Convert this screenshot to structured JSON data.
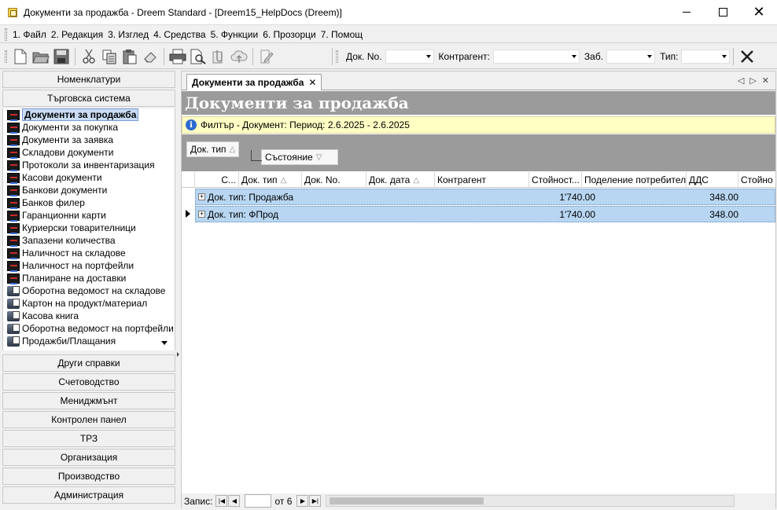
{
  "window": {
    "title": "Документи за продажба - Dreem Standard - [Dreem15_HelpDocs (Dreem)]",
    "controls": [
      "minimize",
      "maximize",
      "close"
    ]
  },
  "menu": [
    {
      "label": "1. Файл"
    },
    {
      "label": "2. Редакция"
    },
    {
      "label": "3. Изглед"
    },
    {
      "label": "4. Средства"
    },
    {
      "label": "5. Функции"
    },
    {
      "label": "6. Прозорци"
    },
    {
      "label": "7. Помощ"
    }
  ],
  "toolbar": {
    "icons": [
      "new-document-icon",
      "open-folder-icon",
      "save-icon",
      "cut-icon",
      "copy-icon",
      "paste-icon",
      "eraser-icon",
      "print-icon",
      "print-preview-icon",
      "attach-icon",
      "cloud-upload-icon",
      "edit-icon"
    ],
    "doc_no_label": "Док. No.",
    "counterparty_label": "Контрагент:",
    "note_label": "Заб.",
    "type_label": "Тип:",
    "close_icon": "close-x-icon"
  },
  "sidebar": {
    "top_groups": [
      {
        "label": "Номенклатури"
      },
      {
        "label": "Търговска система"
      }
    ],
    "items": [
      {
        "label": "Документи за продажба",
        "icon": "document-icon",
        "selected": true
      },
      {
        "label": "Документи за покупка",
        "icon": "document-icon"
      },
      {
        "label": "Документи за заявка",
        "icon": "document-icon"
      },
      {
        "label": "Складови документи",
        "icon": "document-icon"
      },
      {
        "label": "Протоколи за инвентаризация",
        "icon": "document-icon"
      },
      {
        "label": "Касови документи",
        "icon": "document-icon"
      },
      {
        "label": "Банкови документи",
        "icon": "document-icon"
      },
      {
        "label": "Банков филер",
        "icon": "document-icon"
      },
      {
        "label": "Гаранционни карти",
        "icon": "document-icon"
      },
      {
        "label": "Куриерски товарителници",
        "icon": "document-icon"
      },
      {
        "label": "Запазени количества",
        "icon": "document-icon"
      },
      {
        "label": "Наличност на складове",
        "icon": "document-icon"
      },
      {
        "label": "Наличност на портфейли",
        "icon": "document-icon"
      },
      {
        "label": "Планиране на доставки",
        "icon": "document-icon"
      },
      {
        "label": "Оборотна ведомост на складове",
        "icon": "report-icon"
      },
      {
        "label": "Картон на продукт/материал",
        "icon": "report-icon"
      },
      {
        "label": "Касова книга",
        "icon": "report-icon"
      },
      {
        "label": "Оборотна ведомост на портфейли",
        "icon": "report-icon"
      },
      {
        "label": "Продажби/Плащания",
        "icon": "report-icon"
      }
    ],
    "bottom_groups": [
      {
        "label": "Други справки"
      },
      {
        "label": "Счетоводство"
      },
      {
        "label": "Мениджмънт"
      },
      {
        "label": "Контролен панел"
      },
      {
        "label": "ТРЗ"
      },
      {
        "label": "Организация"
      },
      {
        "label": "Производство"
      },
      {
        "label": "Администрация"
      }
    ]
  },
  "tab": {
    "label": "Документи за продажба"
  },
  "page": {
    "header": "Документи за продажба",
    "filter": "Филтър - Документ: Период: 2.6.2025 - 2.6.2025",
    "group_chips": [
      "Док. тип",
      "Състояние"
    ]
  },
  "grid": {
    "columns": [
      "С...",
      "Док. тип",
      "Док. No.",
      "Док. дата",
      "Контрагент",
      "Стойност...",
      "Поделение потребител",
      "ДДС",
      "Стойно"
    ],
    "rows": [
      {
        "label": "Док. тип: Продажба",
        "value": "1'740.00",
        "vat": "348.00",
        "current": false
      },
      {
        "label": "Док. тип: ФПрод",
        "value": "1'740.00",
        "vat": "348.00",
        "current": true
      }
    ]
  },
  "statusbar": {
    "records_label": "Запис:",
    "of_label": "от 6"
  }
}
